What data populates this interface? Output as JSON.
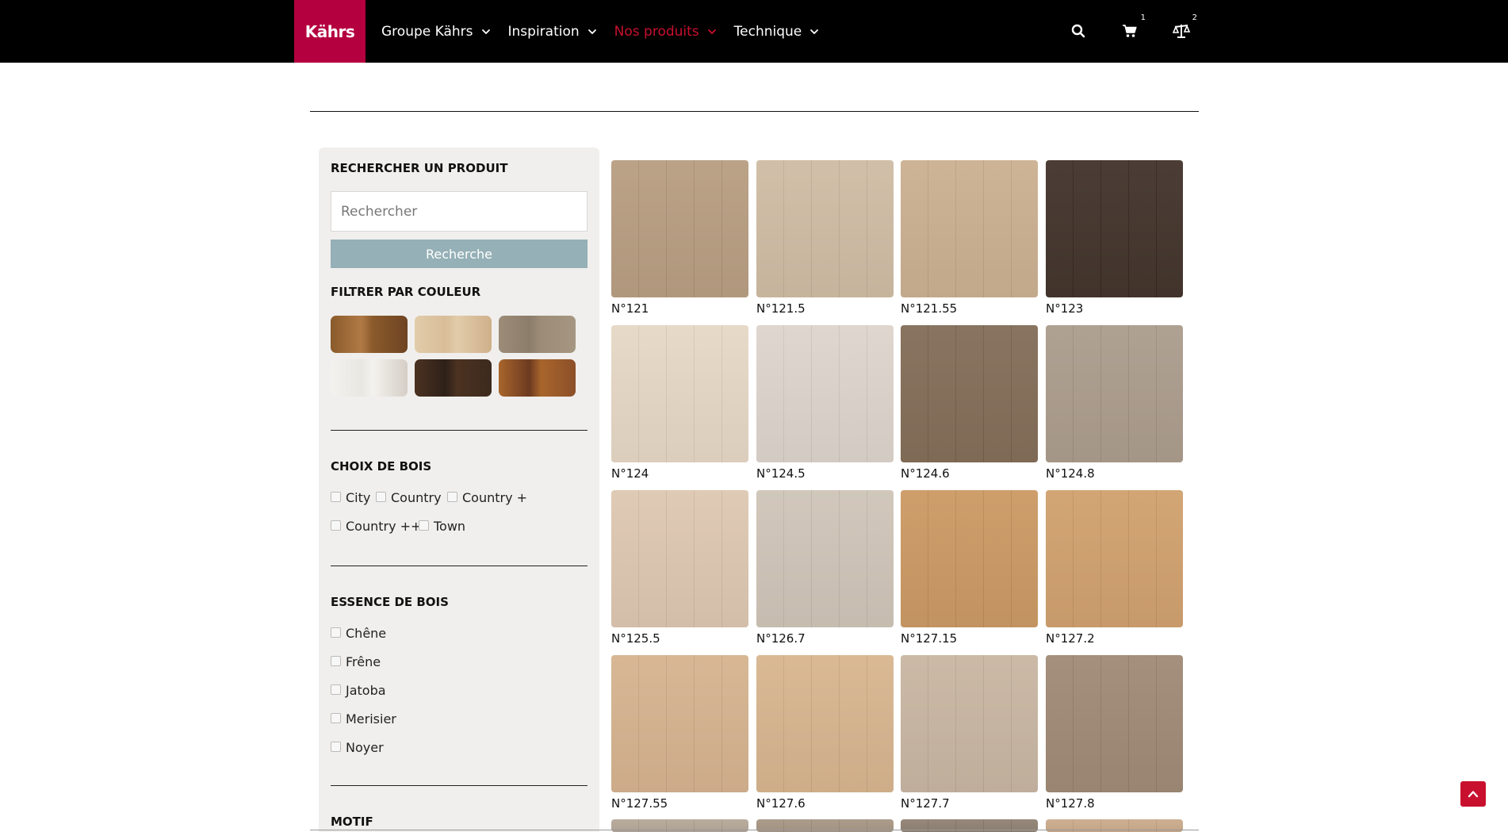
{
  "header": {
    "logo": "Kährs",
    "nav": [
      {
        "label": "Groupe Kährs",
        "active": false
      },
      {
        "label": "Inspiration",
        "active": false
      },
      {
        "label": "Nos produits",
        "active": true
      },
      {
        "label": "Technique",
        "active": false
      }
    ],
    "tools": [
      {
        "name": "search-icon"
      },
      {
        "name": "cart-icon",
        "badge": "1"
      },
      {
        "name": "compare-scale-icon",
        "badge": "2"
      }
    ],
    "active_color": "#c8102e",
    "brand_color": "#b5003f"
  },
  "sidebar": {
    "search_heading": "RECHERCHER UN PRODUIT",
    "search_placeholder": "Rechercher",
    "search_button": "Recherche",
    "color_heading": "FILTRER PAR COULEUR",
    "color_swatches": [
      {
        "name": "swatch-warm-brown",
        "colors": [
          "#8a5a2b",
          "#b07a45",
          "#6e4422"
        ]
      },
      {
        "name": "swatch-light-natural",
        "colors": [
          "#e2ccaa",
          "#d8bd98",
          "#cfb08a"
        ]
      },
      {
        "name": "swatch-grey-brown",
        "colors": [
          "#9c8c78",
          "#8c7c6a",
          "#a59682"
        ]
      },
      {
        "name": "swatch-white-grey",
        "colors": [
          "#f3f2ee",
          "#e9e7e2",
          "#d5cec6"
        ]
      },
      {
        "name": "swatch-dark-brown",
        "colors": [
          "#4b3221",
          "#2e2018",
          "#3c2a1e"
        ]
      },
      {
        "name": "swatch-red-brown",
        "colors": [
          "#a8652c",
          "#6d3a20",
          "#8c4f28"
        ]
      }
    ],
    "grade_heading": "CHOIX DE BOIS",
    "grades": [
      "City",
      "Country",
      "Country +",
      "Country ++",
      "Town"
    ],
    "species_heading": "ESSENCE DE BOIS",
    "species": [
      "Chêne",
      "Frêne",
      "Jatoba",
      "Merisier",
      "Noyer"
    ],
    "motif_heading": "MOTIF"
  },
  "products": [
    {
      "label": "N°121",
      "color": "#b59a7c"
    },
    {
      "label": "N°121.5",
      "color": "#cdb9a0"
    },
    {
      "label": "N°121.55",
      "color": "#c9ad8c"
    },
    {
      "label": "N°123",
      "color": "#3a2b22"
    },
    {
      "label": "N°124",
      "color": "#e5d6c2"
    },
    {
      "label": "N°124.5",
      "color": "#dcd3ca"
    },
    {
      "label": "N°124.6",
      "color": "#7d6750"
    },
    {
      "label": "N°124.8",
      "color": "#a89888"
    },
    {
      "label": "N°125.5",
      "color": "#dcc5ae"
    },
    {
      "label": "N°126.7",
      "color": "#cdc2b5"
    },
    {
      "label": "N°127.15",
      "color": "#c9955d"
    },
    {
      "label": "N°127.2",
      "color": "#cf9d68"
    },
    {
      "label": "N°127.55",
      "color": "#d4b08a"
    },
    {
      "label": "N°127.6",
      "color": "#d6b28a"
    },
    {
      "label": "N°127.7",
      "color": "#c6b39e"
    },
    {
      "label": "N°127.8",
      "color": "#9c8570"
    }
  ],
  "partial_row_colors": [
    "#b3a595",
    "#a59381",
    "#8c7d6e",
    "#c9a888"
  ]
}
